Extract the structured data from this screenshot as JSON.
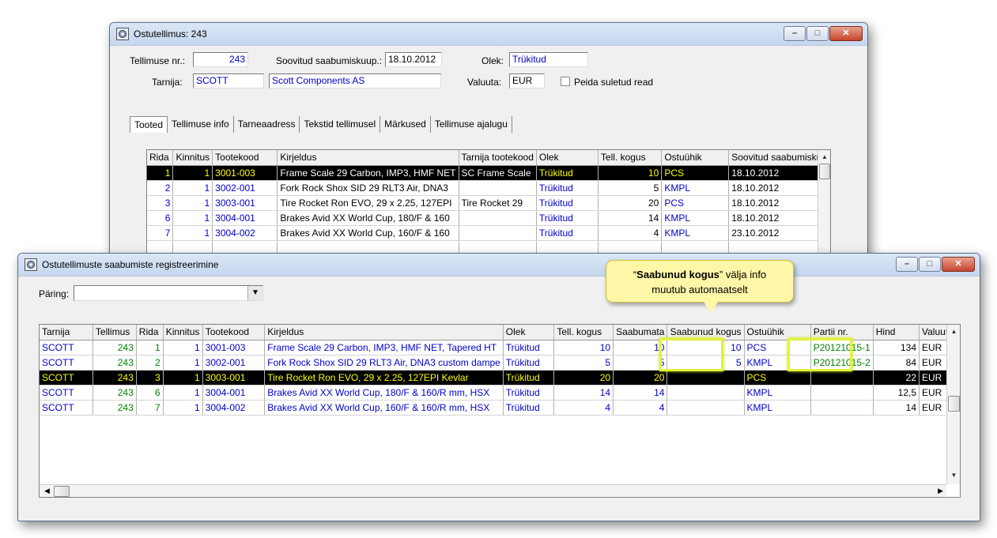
{
  "win1": {
    "title": "Ostutellimus: 243",
    "order_no_label": "Tellimuse nr.:",
    "order_no": "243",
    "wish_date_label": "Soovitud saabumiskuup.:",
    "wish_date": "18.10.2012",
    "status_label": "Olek:",
    "status": "Trükitud",
    "supplier_label": "Tarnija:",
    "supplier_code": "SCOTT",
    "supplier_name": "Scott Components AS",
    "currency_label": "Valuuta:",
    "currency": "EUR",
    "hide_closed_label": "Peida suletud read",
    "tabs": [
      "Tooted",
      "Tellimuse info",
      "Tarneaadress",
      "Tekstid tellimusel",
      "Märkused",
      "Tellimuse ajalugu"
    ],
    "columns": [
      "Rida",
      "Kinnitus",
      "Tootekood",
      "Kirjeldus",
      "Tarnija tootekood",
      "Olek",
      "Tell. kogus",
      "Ostuühik",
      "Soovitud saabumiskuu"
    ],
    "rows": [
      [
        "1",
        "1",
        "3001-003",
        "Frame Scale 29 Carbon, IMP3, HMF NET",
        "SC Frame Scale",
        "Trükitud",
        "10",
        "PCS",
        "18.10.2012"
      ],
      [
        "2",
        "1",
        "3002-001",
        "Fork Rock Shox SID 29 RLT3 Air, DNA3",
        "",
        "Trükitud",
        "5",
        "KMPL",
        "18.10.2012"
      ],
      [
        "3",
        "1",
        "3003-001",
        "Tire Rocket Ron EVO, 29 x 2.25, 127EPI",
        "Tire Rocket 29",
        "Trükitud",
        "20",
        "PCS",
        "18.10.2012"
      ],
      [
        "6",
        "1",
        "3004-001",
        "Brakes Avid XX World Cup, 180/F & 160",
        "",
        "Trükitud",
        "14",
        "KMPL",
        "18.10.2012"
      ],
      [
        "7",
        "1",
        "3004-002",
        "Brakes Avid XX World Cup, 160/F & 160",
        "",
        "Trükitud",
        "4",
        "KMPL",
        "23.10.2012"
      ]
    ]
  },
  "win2": {
    "title": "Ostutellimuste saabumiste registreerimine",
    "query_label": "Päring:",
    "query_value": "",
    "columns": [
      "Tarnija",
      "Tellimus",
      "Rida",
      "Kinnitus",
      "Tootekood",
      "Kirjeldus",
      "Olek",
      "Tell. kogus",
      "Saabumata",
      "Saabunud kogus",
      "Ostuühik",
      "Partii nr.",
      "Hind",
      "Valuuta"
    ],
    "rows": [
      [
        "SCOTT",
        "243",
        "1",
        "1",
        "3001-003",
        "Frame Scale 29 Carbon, IMP3, HMF NET, Tapered HT",
        "Trükitud",
        "10",
        "10",
        "10",
        "PCS",
        "P20121015-1",
        "134",
        "EUR"
      ],
      [
        "SCOTT",
        "243",
        "2",
        "1",
        "3002-001",
        "Fork Rock Shox SID 29 RLT3 Air, DNA3 custom dampe",
        "Trükitud",
        "5",
        "5",
        "5",
        "KMPL",
        "P20121015-2",
        "84",
        "EUR"
      ],
      [
        "SCOTT",
        "243",
        "3",
        "1",
        "3003-001",
        "Tire Rocket Ron EVO, 29 x 2.25, 127EPI Kevlar",
        "Trükitud",
        "20",
        "20",
        "",
        "PCS",
        "",
        "22",
        "EUR"
      ],
      [
        "SCOTT",
        "243",
        "6",
        "1",
        "3004-001",
        "Brakes Avid XX World Cup, 180/F & 160/R mm, HSX",
        "Trükitud",
        "14",
        "14",
        "",
        "KMPL",
        "",
        "12,5",
        "EUR"
      ],
      [
        "SCOTT",
        "243",
        "7",
        "1",
        "3004-002",
        "Brakes Avid XX World Cup, 160/F & 160/R mm, HSX",
        "Trükitud",
        "4",
        "4",
        "",
        "KMPL",
        "",
        "14",
        "EUR"
      ]
    ]
  },
  "callout": {
    "open_quote": "“",
    "bold": "Saabunud kogus",
    "rest": "” välja info",
    "line2": "muutub automaatselt"
  },
  "colors": {
    "highlight": "#e3f23a",
    "callout_bg": "#fff6a8",
    "selection_fg": "#ffff00",
    "link_blue": "#0000cc",
    "green": "#008000"
  }
}
